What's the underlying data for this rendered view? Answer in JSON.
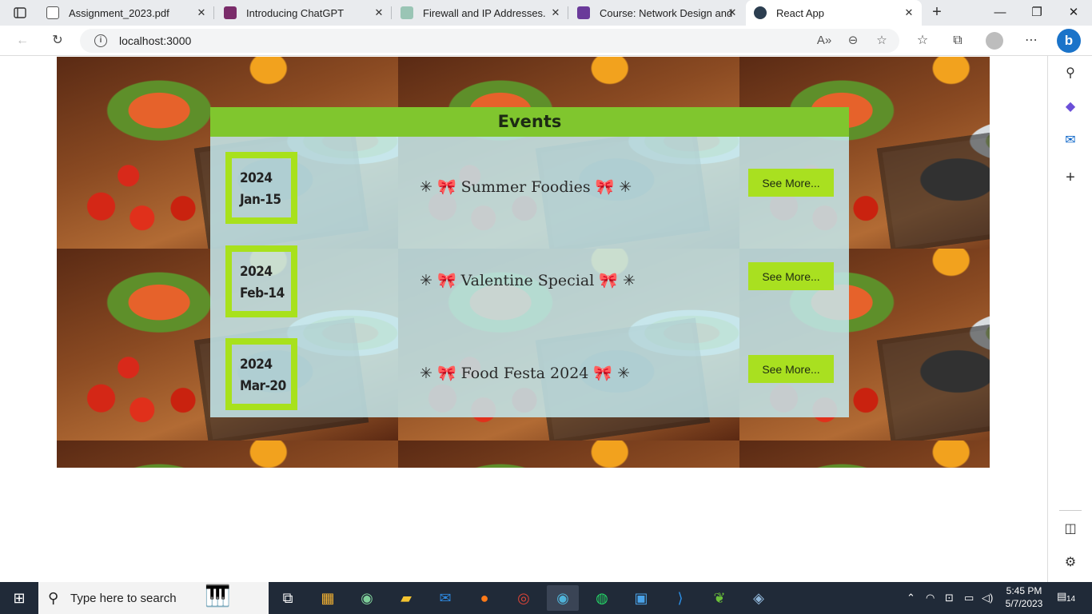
{
  "browser": {
    "tabs": [
      {
        "title": "Assignment_2023.pdf",
        "favicon": "pdf-icon",
        "color": "#666666"
      },
      {
        "title": "Introducing ChatGPT",
        "favicon": "chatgpt-icon",
        "color": "#7a2c6a"
      },
      {
        "title": "Firewall and IP Addresses.",
        "favicon": "chatgpt-icon",
        "color": "#9ac5b5"
      },
      {
        "title": "Course: Network Design and",
        "favicon": "course-icon",
        "color": "#6a3a9a"
      },
      {
        "title": "React App",
        "favicon": "react-icon",
        "color": "#2c3e50"
      }
    ],
    "url": "localhost:3000"
  },
  "page": {
    "events_title": "Events",
    "events": [
      {
        "year": "2024",
        "day": "Jan-15",
        "name": "✳ 🎀 Summer Foodies 🎀 ✳",
        "button": "See More..."
      },
      {
        "year": "2024",
        "day": "Feb-14",
        "name": "✳ 🎀 Valentine Special 🎀 ✳",
        "button": "See More..."
      },
      {
        "year": "2024",
        "day": "Mar-20",
        "name": "✳ 🎀 Food Festa 2024 🎀 ✳",
        "button": "See More..."
      }
    ],
    "colors": {
      "header": "#80c62e",
      "accent": "#a8e11c",
      "panel": "#c4e8ec"
    }
  },
  "taskbar": {
    "search_placeholder": "Type here to search",
    "time": "5:45 PM",
    "date": "5/7/2023",
    "notification_count": "14"
  }
}
